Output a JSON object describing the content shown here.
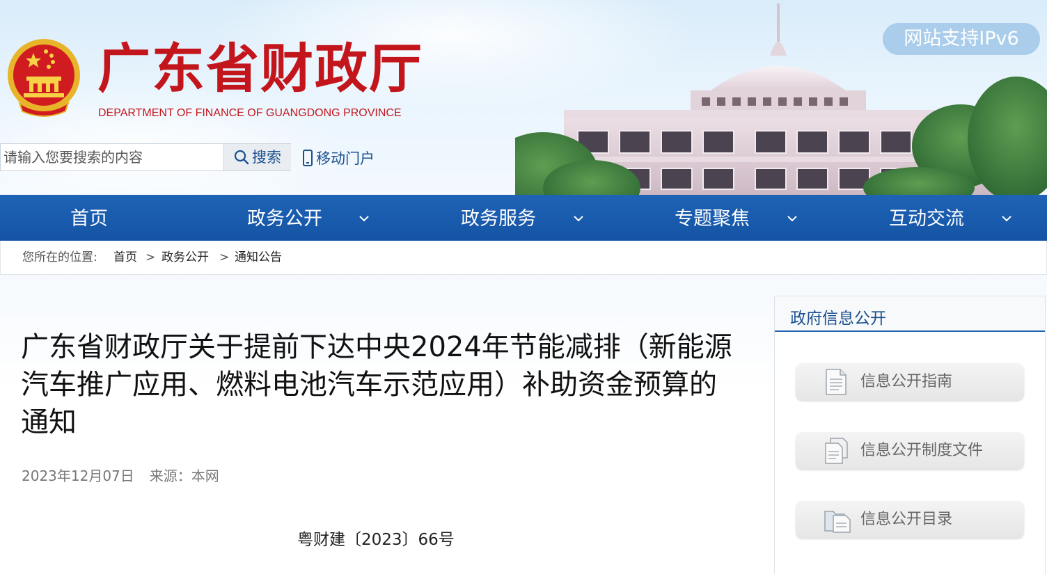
{
  "header": {
    "site_title": "广东省财政厅",
    "site_subtitle": "DEPARTMENT OF FINANCE OF GUANGDONG PROVINCE",
    "ipv6_badge": "网站支持IPv6",
    "search": {
      "placeholder": "请输入您要搜索的内容",
      "value": "",
      "button_label": "搜索"
    },
    "mobile_link": "移动门户"
  },
  "nav": {
    "items": [
      {
        "label": "首页",
        "has_dropdown": false
      },
      {
        "label": "政务公开",
        "has_dropdown": true
      },
      {
        "label": "政务服务",
        "has_dropdown": true
      },
      {
        "label": "专题聚焦",
        "has_dropdown": true
      },
      {
        "label": "互动交流",
        "has_dropdown": true
      }
    ]
  },
  "breadcrumb": {
    "prefix": "您所在的位置:",
    "separator": ">",
    "items": [
      "首页",
      "政务公开",
      "通知公告"
    ]
  },
  "article": {
    "title": "广东省财政厅关于提前下达中央2024年节能减排（新能源汽车推广应用、燃料电池汽车示范应用）补助资金预算的通知",
    "date": "2023年12月07日",
    "source": "来源：本网",
    "doc_number": "粤财建〔2023〕66号"
  },
  "sidebar": {
    "title": "政府信息公开",
    "buttons": [
      {
        "label": "信息公开指南",
        "icon": "document-icon"
      },
      {
        "label": "信息公开制度文件",
        "icon": "documents-stack-icon"
      },
      {
        "label": "信息公开目录",
        "icon": "folder-catalog-icon"
      }
    ]
  },
  "colors": {
    "brand_red": "#c3161c",
    "nav_blue": "#1a5bae",
    "link_blue": "#1b4f8e",
    "ipv6_badge_bg": "#a9cdea"
  }
}
